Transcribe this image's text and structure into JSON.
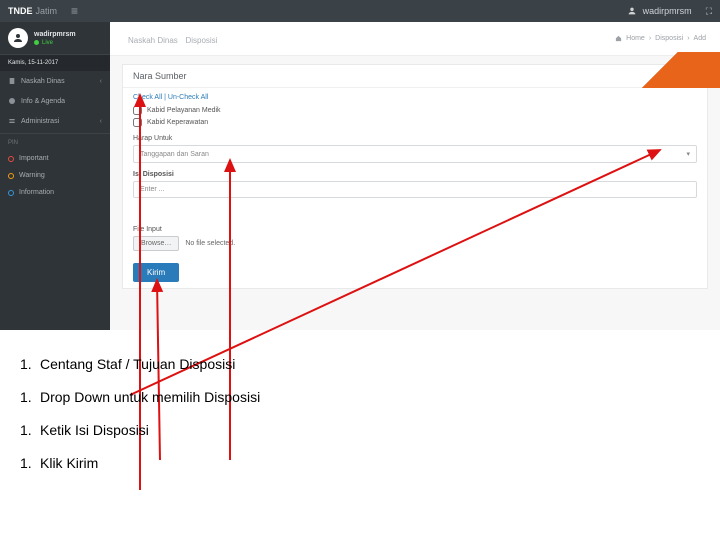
{
  "topbar": {
    "brand_bold": "TNDE",
    "brand_light": "Jatim",
    "user": "wadirpmrsm"
  },
  "sidebar": {
    "username": "wadirpmrsm",
    "role": "Live",
    "date": "Kamis, 15-11-2017",
    "items": [
      {
        "label": "Naskah Dinas",
        "chev": "‹"
      },
      {
        "label": "Info & Agenda"
      },
      {
        "label": "Administrasi",
        "chev": "‹"
      }
    ],
    "section": "Pin",
    "pins": [
      {
        "label": "Important",
        "cls": "red"
      },
      {
        "label": "Warning",
        "cls": "orange"
      },
      {
        "label": "Information",
        "cls": "blue"
      }
    ]
  },
  "main": {
    "title": "Naskah Dinas",
    "subtitle": "Disposisi",
    "breadcrumb": [
      "Home",
      "Disposisi",
      "Add"
    ]
  },
  "panel": {
    "title": "Nara Sumber",
    "check_all": "Check All",
    "uncheck_all": "Un-Check All",
    "checks": [
      "Kabid Pelayanan Medik",
      "Kabid Keperawatan"
    ],
    "label_harap": "Harap Untuk",
    "select_harap": "Tanggapan dan Saran",
    "label_isi": "Isi Disposisi",
    "placeholder_isi": "Enter ...",
    "label_file": "File Input",
    "browse": "Browse…",
    "no_file": "No file selected.",
    "submit": "Kirim"
  },
  "notes": [
    "Centang Staf / Tujuan Disposisi",
    "Drop Down untuk memilih Disposisi",
    "Ketik Isi Disposisi",
    "Klik Kirim"
  ]
}
